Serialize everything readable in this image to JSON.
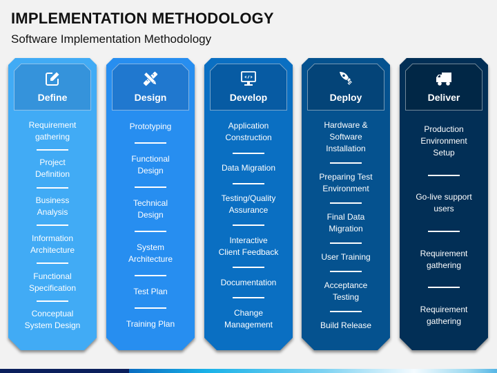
{
  "header": {
    "title": "IMPLEMENTATION METHODOLOGY",
    "subtitle": "Software Implementation Methodology"
  },
  "colors": {
    "define": "#41abf5",
    "design": "#278ef0",
    "develop": "#0a6fc2",
    "deploy": "#05528f",
    "deliver": "#022f56"
  },
  "columns": [
    {
      "title": "Define",
      "icon": "edit-icon",
      "items": [
        "Requirement\ngathering",
        "Project\nDefinition",
        "Business\nAnalysis",
        "Information\nArchitecture",
        "Functional\nSpecification",
        "Conceptual\nSystem Design"
      ]
    },
    {
      "title": "Design",
      "icon": "ruler-pencil-icon",
      "items": [
        "Prototyping",
        "Functional\nDesign",
        "Technical\nDesign",
        "System\nArchitecture",
        "Test Plan",
        "Training Plan"
      ]
    },
    {
      "title": "Develop",
      "icon": "monitor-code-icon",
      "items": [
        "Application\nConstruction",
        "Data Migration",
        "Testing/Quality\nAssurance",
        "Interactive\nClient Feedback",
        "Documentation",
        "Change\nManagement"
      ]
    },
    {
      "title": "Deploy",
      "icon": "rocket-icon",
      "items": [
        "Hardware &\nSoftware\nInstallation",
        "Preparing Test\nEnvironment",
        "Final Data\nMigration",
        "User Training",
        "Acceptance\nTesting",
        "Build Release"
      ]
    },
    {
      "title": "Deliver",
      "icon": "truck-icon",
      "items": [
        "Production\nEnvironment\nSetup",
        "Go-live support\nusers",
        "Requirement\ngathering",
        "Requirement\ngathering"
      ]
    }
  ]
}
